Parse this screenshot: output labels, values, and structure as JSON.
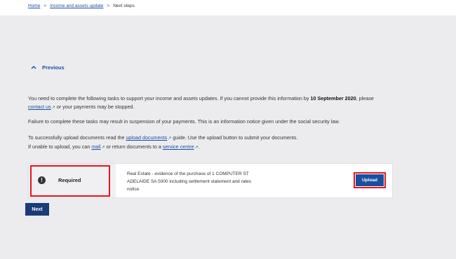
{
  "breadcrumb": {
    "home": "Home",
    "sep1": ">",
    "update": "Income and assets update",
    "sep2": ">",
    "current": "Next steps"
  },
  "previous_label": "Previous",
  "intro": {
    "line1_pre": "You need to complete the following tasks to support your income and assets updates. If you cannot provide this information by ",
    "line1_date": "10 September 2020",
    "line1_post": ", please",
    "line2_link": "contact us",
    "line2_post": " or your payments may be stopped."
  },
  "warning": "Failure to complete these tasks may result in suspension of your payments. This is an information notice given under the social security law.",
  "upload_info": {
    "line1_pre": "To successfully upload documents read the ",
    "line1_link": "upload documents",
    "line1_post": " guide. Use the upload button to submit your documents.",
    "line2_pre": "If unable to upload, you can ",
    "line2_link1": "mail",
    "line2_mid": " or return documents to a ",
    "line2_link2": "service centre",
    "line2_post": "."
  },
  "task": {
    "status": "Required",
    "description_lines": [
      "Real Estate - evidence of the purchase of 1 COMPUTER ST",
      "ADELAIDE SA 5000 including settlement statement and rates",
      "notice"
    ],
    "upload_label": "Upload"
  },
  "next_label": "Next",
  "icons": {
    "external": "external-link-icon",
    "warning": "exclamation-icon",
    "previous": "chevron-up-icon"
  },
  "colors": {
    "link": "#1a4fa0",
    "highlight": "#e3161e",
    "primary_button": "#1a4fa0",
    "next_button": "#1a3c78"
  }
}
